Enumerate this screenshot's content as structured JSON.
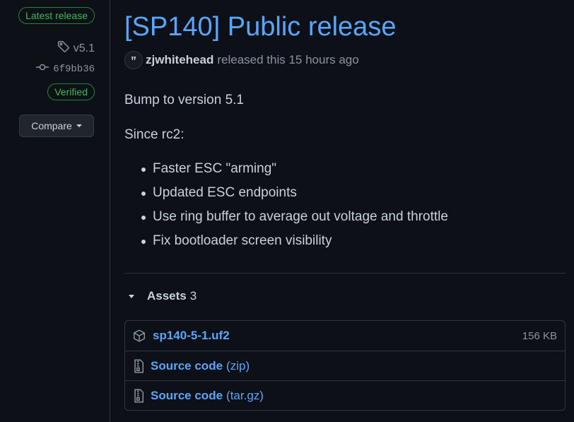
{
  "sidebar": {
    "latest_label": "Latest release",
    "tag": "v5.1",
    "commit": "6f9bb36",
    "verified_label": "Verified",
    "compare_label": "Compare"
  },
  "release": {
    "title": "[SP140] Public release",
    "author": "zjwhitehead",
    "released_text": "released this 15 hours ago",
    "body": {
      "line1": "Bump to version 5.1",
      "line2": "Since rc2:",
      "items": [
        "Faster ESC \"arming\"",
        "Updated ESC endpoints",
        "Use ring buffer to average out voltage and throttle",
        "Fix bootloader screen visibility"
      ]
    }
  },
  "assets": {
    "title": "Assets",
    "count": "3",
    "items": [
      {
        "name": "sp140-5-1.uf2",
        "size": "156 KB",
        "icon": "package-icon"
      },
      {
        "name": "Source code",
        "ext": "(zip)",
        "icon": "file-zip-icon"
      },
      {
        "name": "Source code",
        "ext": "(tar.gz)",
        "icon": "file-zip-icon"
      }
    ]
  },
  "colors": {
    "link": "#58a6ff",
    "success": "#3fb950",
    "background": "#0d1117",
    "muted": "#8b949e"
  }
}
